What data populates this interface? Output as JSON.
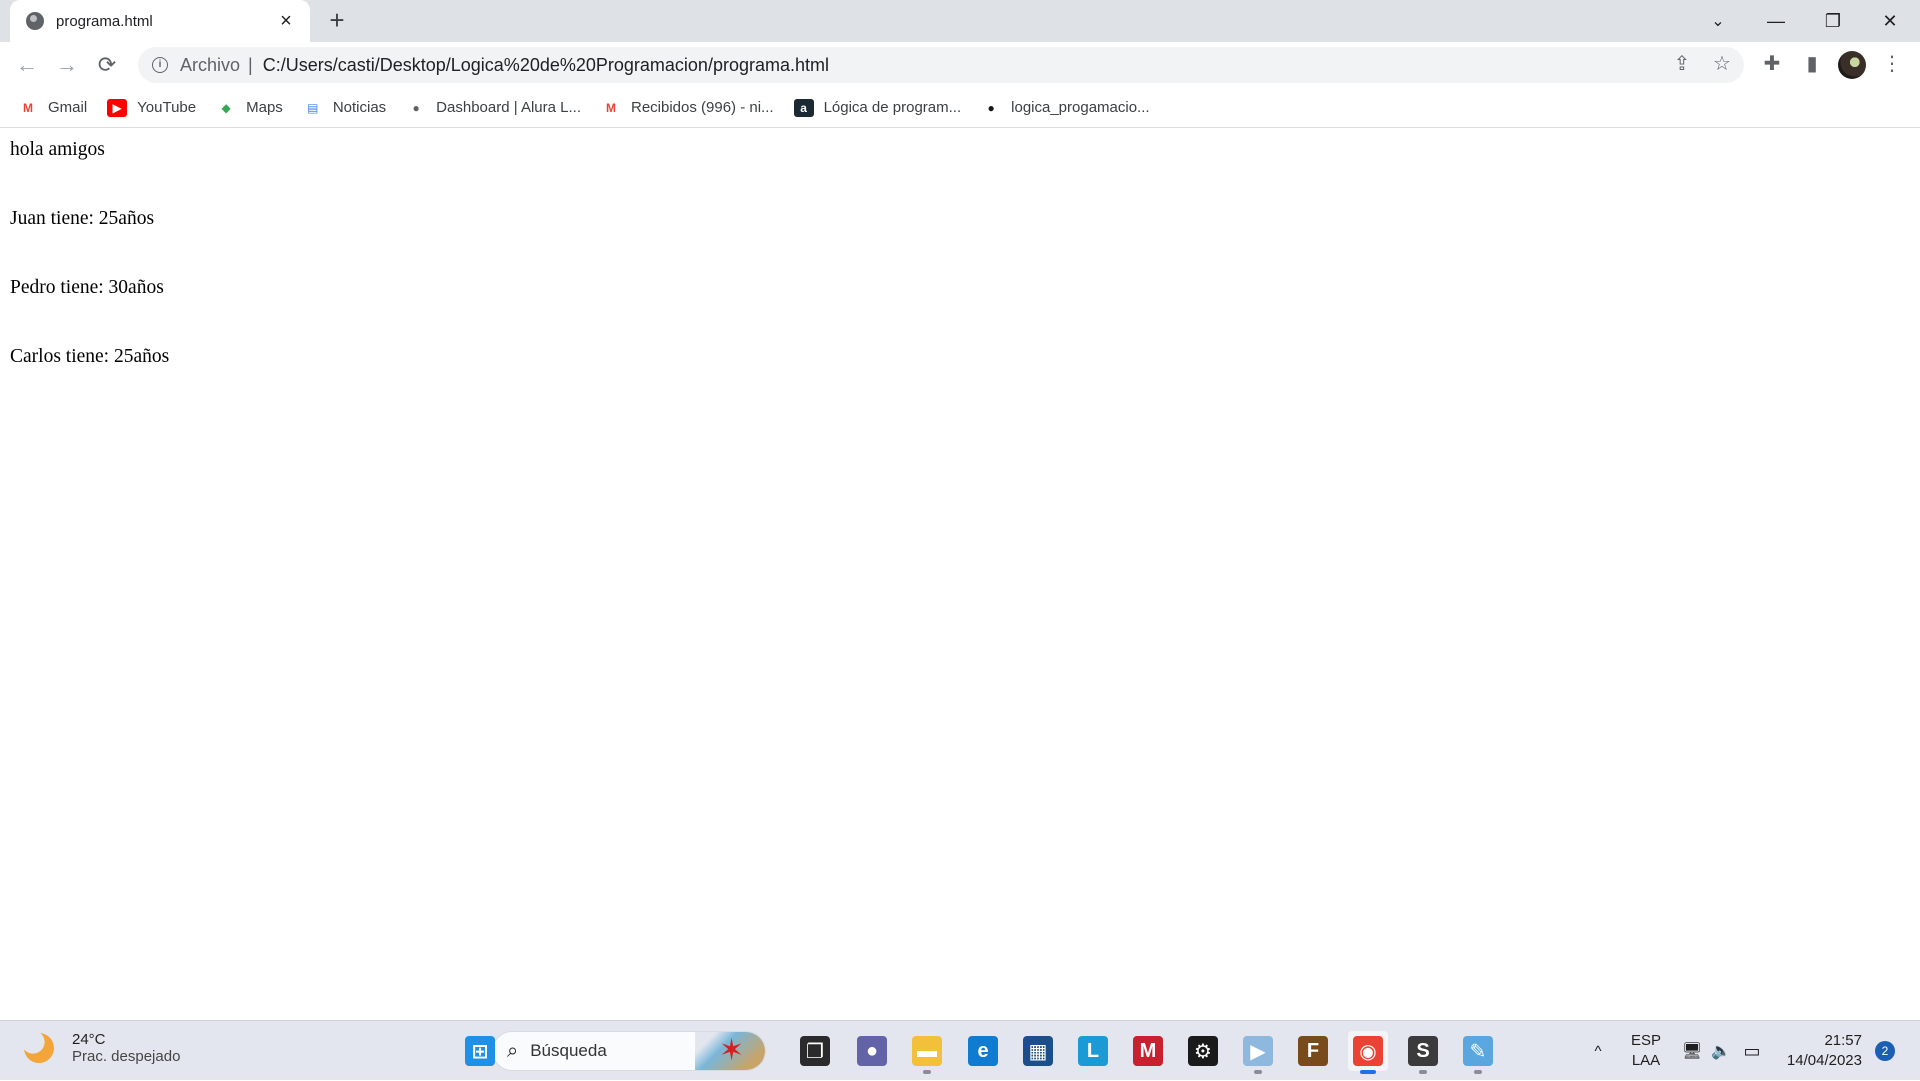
{
  "browser": {
    "tab": {
      "title": "programa.html",
      "close": "×",
      "favicon": "globe-icon"
    },
    "new_tab": "+",
    "window_controls": {
      "tab_search": "⌄",
      "minimize": "—",
      "restore": "❐",
      "close": "✕"
    },
    "toolbar": {
      "back": "←",
      "forward": "→",
      "reload": "⟳",
      "address": {
        "info_icon": "i",
        "scheme_label": "Archivo",
        "separator": "|",
        "url": "C:/Users/casti/Desktop/Logica%20de%20Programacion/programa.html"
      },
      "share": "⇪",
      "bookmark_star": "☆",
      "extensions": "✚",
      "side_panel": "▮",
      "menu": "⋮"
    },
    "bookmarks": [
      {
        "label": "Gmail",
        "icon": "gmail-icon",
        "glyph": "M",
        "color": "#ea4335",
        "bg": "transparent"
      },
      {
        "label": "YouTube",
        "icon": "youtube-icon",
        "glyph": "▶",
        "color": "#ffffff",
        "bg": "#ff0000"
      },
      {
        "label": "Maps",
        "icon": "maps-icon",
        "glyph": "◆",
        "color": "#34a853",
        "bg": "transparent"
      },
      {
        "label": "Noticias",
        "icon": "news-icon",
        "glyph": "▤",
        "color": "#4285f4",
        "bg": "transparent"
      },
      {
        "label": "Dashboard | Alura L...",
        "icon": "globe-icon",
        "glyph": "●",
        "color": "#5f6368",
        "bg": "transparent"
      },
      {
        "label": "Recibidos (996) - ni...",
        "icon": "gmail-icon",
        "glyph": "M",
        "color": "#ea4335",
        "bg": "transparent"
      },
      {
        "label": "Lógica de program...",
        "icon": "alura-icon",
        "glyph": "a",
        "color": "#ffffff",
        "bg": "#1c2a33"
      },
      {
        "label": "logica_progamacio...",
        "icon": "github-icon",
        "glyph": "●",
        "color": "#181717",
        "bg": "transparent"
      }
    ]
  },
  "page": {
    "lines": [
      "hola amigos",
      "Juan tiene: 25años",
      "Pedro tiene: 30años",
      "Carlos tiene: 25años"
    ]
  },
  "taskbar": {
    "weather": {
      "temp": "24°C",
      "desc": "Prac. despejado"
    },
    "search_placeholder": "Búsqueda",
    "search_icon": "⌕",
    "apps": [
      {
        "name": "start-button",
        "glyph": "⊞",
        "bg": "#1e90e8"
      },
      {
        "name": "task-view",
        "glyph": "❐",
        "bg": "#2b2b2b"
      },
      {
        "name": "teams-chat",
        "glyph": "●",
        "bg": "#6264a7"
      },
      {
        "name": "file-explorer",
        "glyph": "▬",
        "bg": "#f3c03b"
      },
      {
        "name": "edge",
        "glyph": "e",
        "bg": "#0f7bd1"
      },
      {
        "name": "microsoft-store",
        "glyph": "▦",
        "bg": "#1a4f8b"
      },
      {
        "name": "l-app",
        "glyph": "L",
        "bg": "#1b9ad6"
      },
      {
        "name": "mcafee",
        "glyph": "M",
        "bg": "#c8202f"
      },
      {
        "name": "driver-booster",
        "glyph": "⚙",
        "bg": "#1a1a1a"
      },
      {
        "name": "media-player",
        "glyph": "▶",
        "bg": "#8fb8de"
      },
      {
        "name": "crossfire",
        "glyph": "F",
        "bg": "#7a4b1a"
      },
      {
        "name": "chrome",
        "glyph": "◉",
        "bg": "#ea4335"
      },
      {
        "name": "sublime-text",
        "glyph": "S",
        "bg": "#3b3b3b"
      },
      {
        "name": "paint",
        "glyph": "✎",
        "bg": "#5aa7e0"
      }
    ],
    "tray": {
      "chevron": "^",
      "lang_top": "ESP",
      "lang_bottom": "LAA",
      "network": "🖥",
      "volume": "🔈",
      "battery": "▭",
      "time": "21:57",
      "date": "14/04/2023",
      "notifications": "2"
    }
  }
}
